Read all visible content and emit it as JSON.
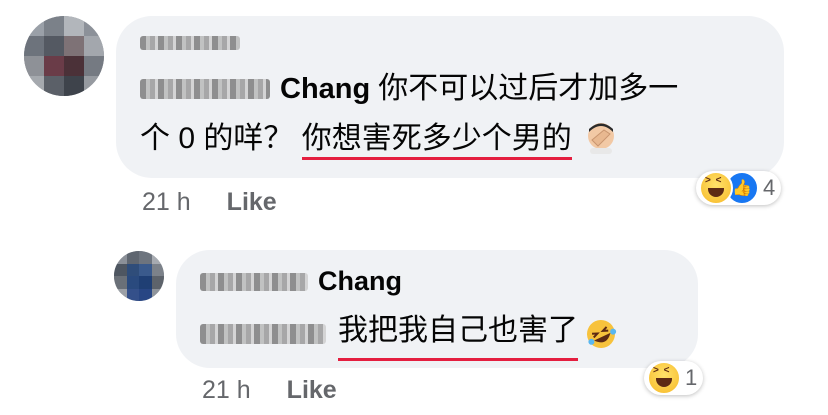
{
  "comments": [
    {
      "author_visible": "Chang",
      "text_part1": "你不可以过后才加多一",
      "text_part2": "个 0 的咩？",
      "text_underlined": "你想害死多少个男的",
      "inline_emoji": "facepalm-emoji",
      "time": "21 h",
      "like_label": "Like",
      "reaction_count": "4",
      "reactions": [
        "haha-icon",
        "like-icon"
      ]
    },
    {
      "author_visible": "Chang",
      "text_underlined": "我把我自己也害了",
      "inline_emoji": "rofl-emoji",
      "time": "21 h",
      "like_label": "Like",
      "reaction_count": "1",
      "reactions": [
        "haha-icon"
      ]
    }
  ],
  "colors": {
    "bubble": "#f0f2f5",
    "underline": "#e41e3f",
    "meta_text": "#65676b",
    "like_blue": "#1877f2"
  }
}
